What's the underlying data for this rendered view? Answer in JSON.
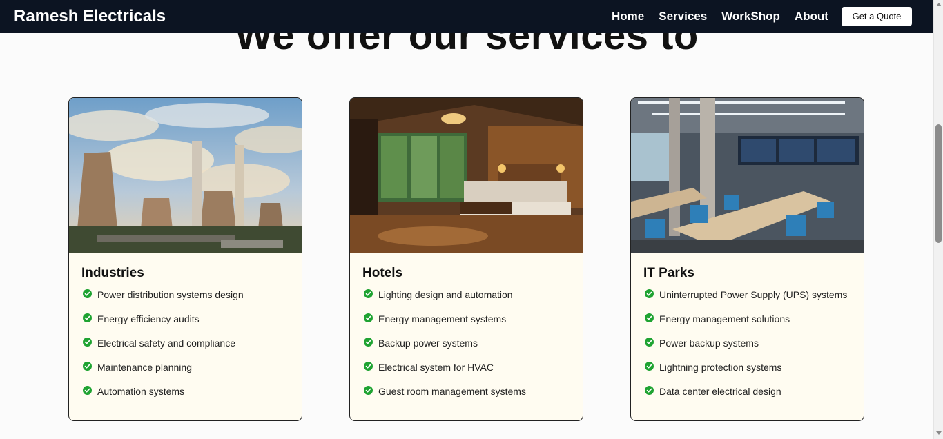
{
  "navbar": {
    "brand": "Ramesh Electricals",
    "links": [
      "Home",
      "Services",
      "WorkShop",
      "About"
    ],
    "cta_label": "Get a Quote"
  },
  "section": {
    "heading": "We offer our services to"
  },
  "cards": [
    {
      "title": "Industries",
      "image": "power-plant-cooling-towers-photo",
      "items": [
        "Power distribution systems design",
        "Energy efficiency audits",
        "Electrical safety and compliance",
        "Maintenance planning",
        "Automation systems"
      ]
    },
    {
      "title": "Hotels",
      "image": "hotel-bedroom-photo",
      "items": [
        "Lighting design and automation",
        "Energy management systems",
        "Backup power systems",
        "Electrical system for HVAC",
        "Guest room management systems"
      ]
    },
    {
      "title": "IT Parks",
      "image": "open-office-workstations-photo",
      "items": [
        "Uninterrupted Power Supply (UPS) systems",
        "Energy management solutions",
        "Power backup systems",
        "Lightning protection systems",
        "Data center electrical design"
      ]
    }
  ],
  "colors": {
    "navbar_bg": "#0c1422",
    "card_bg": "#fffcf1",
    "check_green": "#1fa332",
    "page_bg": "#fbfbfb"
  }
}
